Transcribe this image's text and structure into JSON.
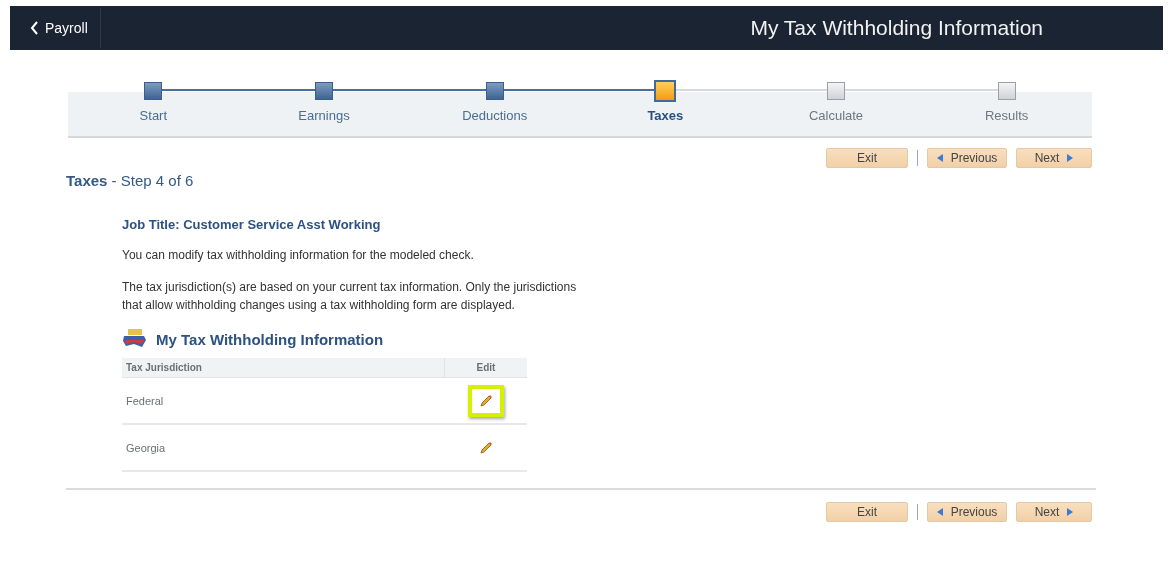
{
  "header": {
    "back_label": "Payroll",
    "title": "My Tax Withholding Information"
  },
  "steps": [
    {
      "label": "Start",
      "completed": true,
      "selected": false
    },
    {
      "label": "Earnings",
      "completed": true,
      "selected": false
    },
    {
      "label": "Deductions",
      "completed": true,
      "selected": false
    },
    {
      "label": "Taxes",
      "completed": false,
      "selected": true
    },
    {
      "label": "Calculate",
      "completed": false,
      "selected": false
    },
    {
      "label": "Results",
      "completed": false,
      "selected": false
    }
  ],
  "top_nav": [
    {
      "kind": "exit",
      "label": "Exit"
    },
    {
      "kind": "previous",
      "label": "Previous"
    },
    {
      "kind": "next",
      "label": "Next"
    }
  ],
  "page_heading": {
    "name": "Taxes",
    "separator": "-",
    "step": "Step 4 of 6"
  },
  "job_title": "Job Title: Customer Service Asst Working",
  "paragraphs": [
    "You can modify tax withholding information for the modeled check.",
    "The tax jurisdiction(s) are based on your current tax information. Only the jurisdictions that allow withholding changes using a tax withholding form are displayed."
  ],
  "section_title": "My Tax Withholding Information",
  "table": {
    "columns": [
      "Tax Jurisdiction",
      "Edit"
    ],
    "rows": [
      {
        "jurisdiction": "Federal",
        "highlighted": true
      },
      {
        "jurisdiction": "Georgia",
        "highlighted": false
      }
    ]
  },
  "bottom_nav": [
    {
      "kind": "exit",
      "label": "Exit"
    },
    {
      "kind": "previous",
      "label": "Previous"
    },
    {
      "kind": "next",
      "label": "Next"
    }
  ]
}
